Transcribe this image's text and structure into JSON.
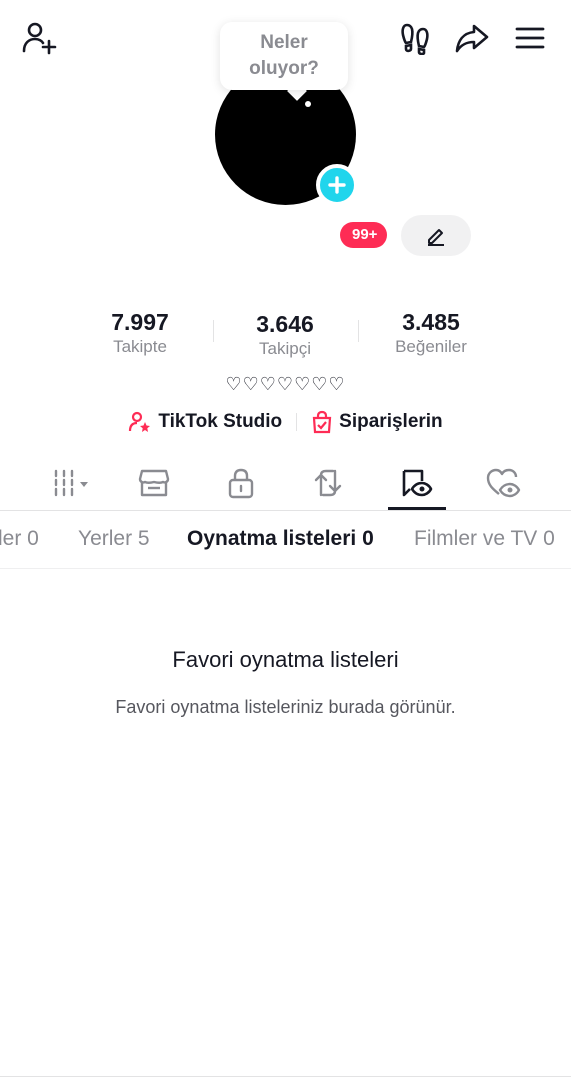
{
  "header": {
    "add_friend_icon": "person-plus-icon",
    "footprints_icon": "footprints-icon",
    "share_icon": "share-arrow-icon",
    "menu_icon": "hamburger-menu-icon"
  },
  "bubble": {
    "line1": "Neler",
    "line2": "oluyor?"
  },
  "profile": {
    "notification_badge": "99+"
  },
  "stats": [
    {
      "value": "7.997",
      "label": "Takipte"
    },
    {
      "value": "3.646",
      "label": "Takipçi"
    },
    {
      "value": "3.485",
      "label": "Beğeniler"
    }
  ],
  "bio": "♡♡♡♡♡♡♡",
  "links": {
    "studio": "TikTok Studio",
    "orders": "Siparişlerin"
  },
  "subtabs": [
    {
      "label": "ler 0"
    },
    {
      "label": "Yerler 5"
    },
    {
      "label": "Oynatma listeleri 0"
    },
    {
      "label": "Filmler ve TV 0"
    }
  ],
  "empty": {
    "title": "Favori oynatma listeleri",
    "subtitle": "Favori oynatma listeleriniz burada görünür."
  },
  "colors": {
    "accent": "#fe2c55",
    "plus": "#20d5ec",
    "text": "#161823",
    "muted": "#8a8b91"
  }
}
